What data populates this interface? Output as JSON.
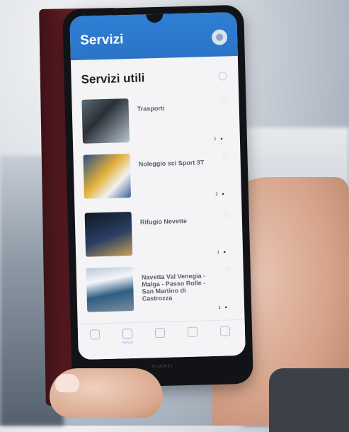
{
  "app": {
    "title": "Servizi",
    "status": "",
    "brand": "HUAWEI"
  },
  "section": {
    "title": "Servizi utili"
  },
  "cards": [
    {
      "category": "",
      "name": "Trasporti",
      "subtitle": "",
      "dots": "1 ●"
    },
    {
      "category": "",
      "name": "Noleggio sci Sport 3T",
      "subtitle": "",
      "dots": "2 ●"
    },
    {
      "category": "",
      "name": "Rifugio Nevette",
      "subtitle": "",
      "dots": "1 ●"
    },
    {
      "category": "",
      "name": "Navetta Val Venegia - Malga - Passo Rolle - San Martino di Castrozza",
      "subtitle": "",
      "dots": "1 ●"
    }
  ],
  "nav": [
    {
      "label": "",
      "icon": "home-icon"
    },
    {
      "label": "Servizi",
      "icon": "services-icon"
    },
    {
      "label": "",
      "icon": "news-icon"
    },
    {
      "label": "",
      "icon": "map-icon"
    },
    {
      "label": "",
      "icon": "menu-icon"
    }
  ],
  "colors": {
    "appbar": "#2f7fd6",
    "card_title": "#5b6066",
    "active_nav": "#8fb1d9",
    "cover": "#6b1f28"
  }
}
